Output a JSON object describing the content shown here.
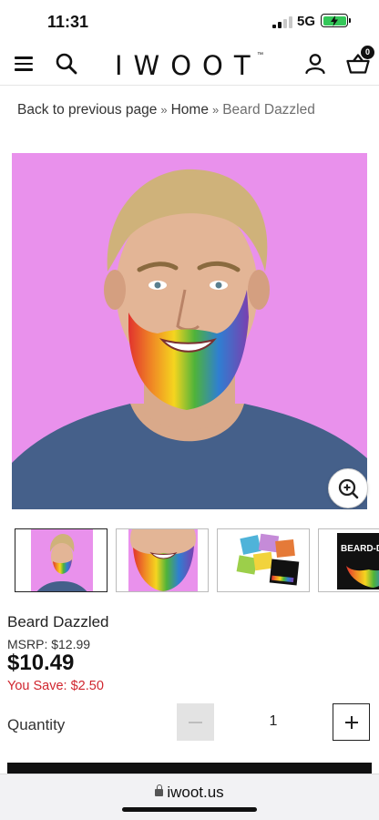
{
  "status_bar": {
    "time": "11:31",
    "network": "5G",
    "battery_charging": true,
    "battery_color": "#34c759"
  },
  "header": {
    "menu_icon": "hamburger-icon",
    "search_icon": "search-icon",
    "logo": "IWOOT",
    "logo_mark": "™",
    "account_icon": "user-icon",
    "basket_icon": "basket-icon",
    "basket_count": "0"
  },
  "breadcrumb": {
    "back": "Back to previous page",
    "separator": "»",
    "home": "Home",
    "current": "Beard Dazzled"
  },
  "gallery": {
    "background_color": "#e991ec",
    "zoom_icon": "zoom-in-icon",
    "thumbnails": [
      {
        "kind": "model-photo",
        "active": true
      },
      {
        "kind": "beard-closeup",
        "active": false
      },
      {
        "kind": "glitter-packets",
        "active": false
      },
      {
        "kind": "product-box",
        "active": false,
        "box_text": "BEARD-DAZZLED"
      }
    ]
  },
  "product": {
    "title": "Beard Dazzled",
    "msrp": "MSRP: $12.99",
    "price": "$10.49",
    "saving": "You Save: $2.50",
    "saving_color": "#d0262f"
  },
  "quantity": {
    "label": "Quantity",
    "value": "1",
    "minus_icon": "minus-icon",
    "plus_icon": "plus-icon"
  },
  "browser": {
    "url": "iwoot.us",
    "lock_icon": "lock-icon"
  }
}
